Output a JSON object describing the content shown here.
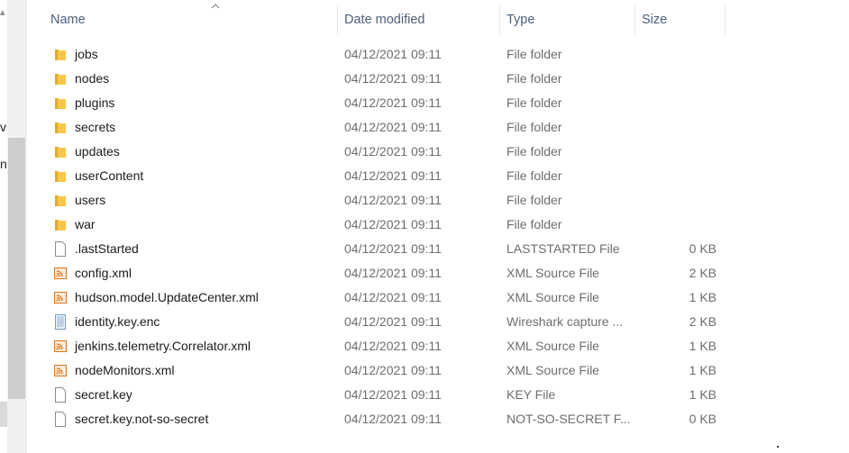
{
  "nav": {
    "fragments": [
      "vi",
      "n"
    ]
  },
  "columns": {
    "name": "Name",
    "date": "Date modified",
    "type": "Type",
    "size": "Size"
  },
  "files": [
    {
      "name": "jobs",
      "date": "04/12/2021 09:11",
      "type": "File folder",
      "size": "",
      "icon": "folder-icon"
    },
    {
      "name": "nodes",
      "date": "04/12/2021 09:11",
      "type": "File folder",
      "size": "",
      "icon": "folder-icon"
    },
    {
      "name": "plugins",
      "date": "04/12/2021 09:11",
      "type": "File folder",
      "size": "",
      "icon": "folder-icon"
    },
    {
      "name": "secrets",
      "date": "04/12/2021 09:11",
      "type": "File folder",
      "size": "",
      "icon": "folder-icon"
    },
    {
      "name": "updates",
      "date": "04/12/2021 09:11",
      "type": "File folder",
      "size": "",
      "icon": "folder-icon"
    },
    {
      "name": "userContent",
      "date": "04/12/2021 09:11",
      "type": "File folder",
      "size": "",
      "icon": "folder-icon"
    },
    {
      "name": "users",
      "date": "04/12/2021 09:11",
      "type": "File folder",
      "size": "",
      "icon": "folder-icon"
    },
    {
      "name": "war",
      "date": "04/12/2021 09:11",
      "type": "File folder",
      "size": "",
      "icon": "folder-icon"
    },
    {
      "name": ".lastStarted",
      "date": "04/12/2021 09:11",
      "type": "LASTSTARTED File",
      "size": "0 KB",
      "icon": "blank-file-icon"
    },
    {
      "name": "config.xml",
      "date": "04/12/2021 09:11",
      "type": "XML Source File",
      "size": "2 KB",
      "icon": "xml-file-icon"
    },
    {
      "name": "hudson.model.UpdateCenter.xml",
      "date": "04/12/2021 09:11",
      "type": "XML Source File",
      "size": "1 KB",
      "icon": "xml-file-icon"
    },
    {
      "name": "identity.key.enc",
      "date": "04/12/2021 09:11",
      "type": "Wireshark capture ...",
      "size": "2 KB",
      "icon": "wireshark-file-icon"
    },
    {
      "name": "jenkins.telemetry.Correlator.xml",
      "date": "04/12/2021 09:11",
      "type": "XML Source File",
      "size": "1 KB",
      "icon": "xml-file-icon"
    },
    {
      "name": "nodeMonitors.xml",
      "date": "04/12/2021 09:11",
      "type": "XML Source File",
      "size": "1 KB",
      "icon": "xml-file-icon"
    },
    {
      "name": "secret.key",
      "date": "04/12/2021 09:11",
      "type": "KEY File",
      "size": "1 KB",
      "icon": "blank-file-icon"
    },
    {
      "name": "secret.key.not-so-secret",
      "date": "04/12/2021 09:11",
      "type": "NOT-SO-SECRET F...",
      "size": "0 KB",
      "icon": "blank-file-icon"
    }
  ],
  "colors": {
    "folder": "#f5c84c",
    "folder_dark": "#e2a92b",
    "xml": "#d9761c",
    "header_text": "#4c607a",
    "meta_text": "#6d6d6d"
  }
}
